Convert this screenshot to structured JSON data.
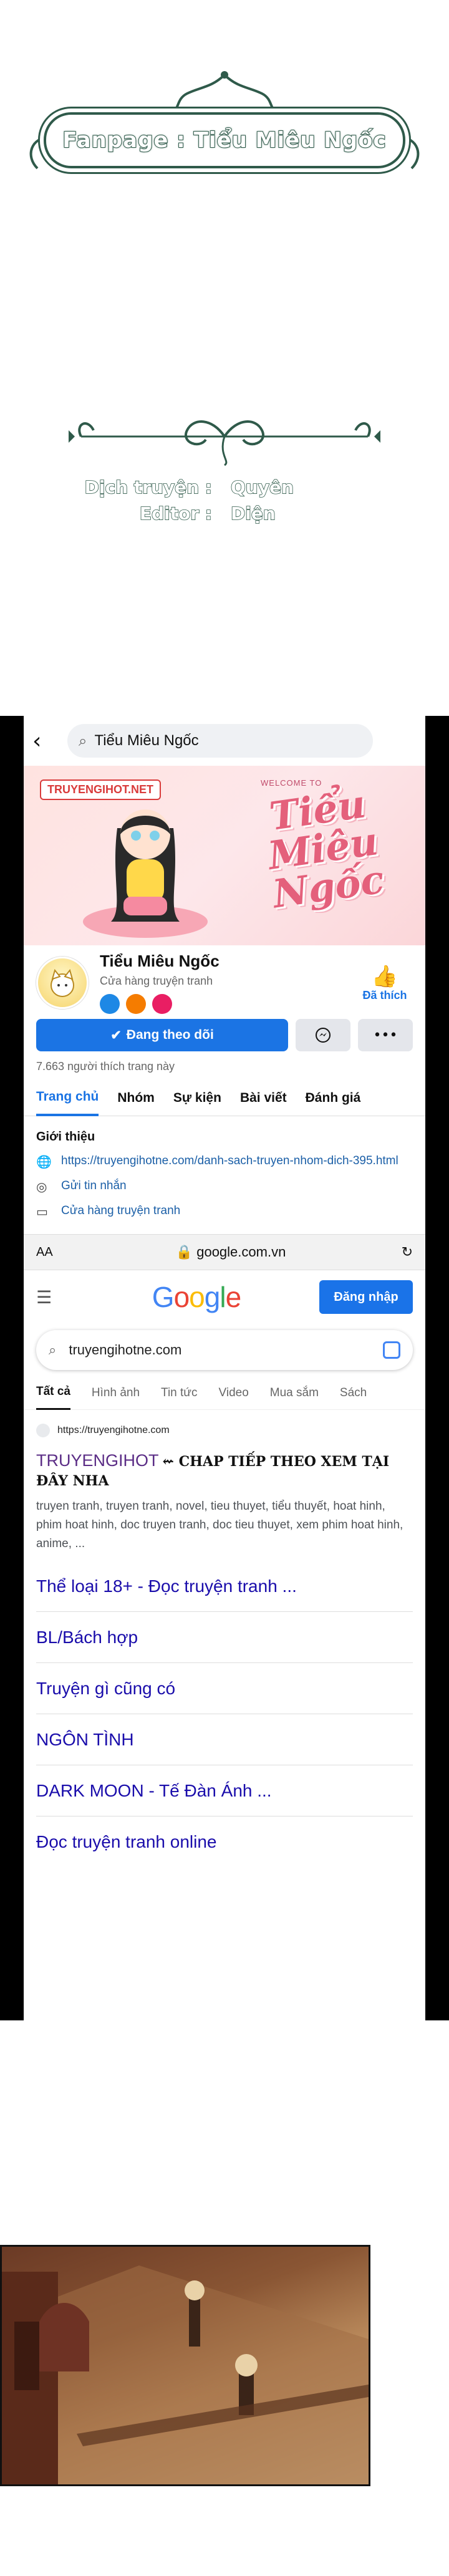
{
  "credits": {
    "fanpage": "Fanpage : Tiểu Miêu Ngốc",
    "translator_label": "Dịch truyện :",
    "translator_value": "Quyên",
    "editor_label": "Editor :",
    "editor_value": "Diện"
  },
  "facebook": {
    "search_text": "Tiểu Miêu Ngốc",
    "cover_watermark": "TRUYENGIHOT.NET",
    "cover_welcome": "WELCOME TO",
    "cover_title": "Tiểu Miêu Ngốc",
    "page_name": "Tiểu Miêu Ngốc",
    "page_category": "Cửa hàng truyện tranh",
    "liked_label": "Đã thích",
    "follow_label": "Đang theo dõi",
    "messenger_icon": "messenger-icon",
    "more_label": "•••",
    "likes_count": "7.663 người thích trang này",
    "tabs": [
      "Trang chủ",
      "Nhóm",
      "Sự kiện",
      "Bài viết",
      "Đánh giá"
    ],
    "intro_title": "Giới thiệu",
    "intro_link": "https://truyengihotne.com/danh-sach-truyen-nhom-dich-395.html",
    "intro_message": "Gửi tin nhắn",
    "intro_shop": "Cửa hàng truyện tranh"
  },
  "browser": {
    "aa_label": "AA",
    "url": "google.com.vn"
  },
  "google": {
    "logo": "Google",
    "signin_label": "Đăng nhập",
    "query": "truyengihotne.com",
    "tabs": [
      "Tất cả",
      "Hình ảnh",
      "Tin tức",
      "Video",
      "Mua sắm",
      "Sách"
    ],
    "result_url": "https://truyengihotne.com",
    "result_title": "TRUYENGIHOT",
    "result_title_extra": "⇜ CHAP TIẾP THEO XEM TẠI ĐÂY NHA",
    "result_snippet": "truyen tranh, truyen tranh, novel, tieu thuyet, tiểu thuyết, hoat hinh, phim hoat hinh, doc truyen tranh, doc tieu thuyet, xem phim hoat hinh, anime, ...",
    "sitelinks": [
      "Thể loại 18+ - Đọc truyện tranh ...",
      "BL/Bách hợp",
      "Truyện gì cũng có",
      "NGÔN TÌNH",
      "DARK MOON - Tế Đàn Ánh ...",
      "Đọc truyện tranh online"
    ]
  },
  "colors": {
    "facebook_blue": "#1b74e4",
    "google_blue": "#1a73e8",
    "ornament_green": "#2f5a4a",
    "visited_purple": "#5b2d86"
  }
}
